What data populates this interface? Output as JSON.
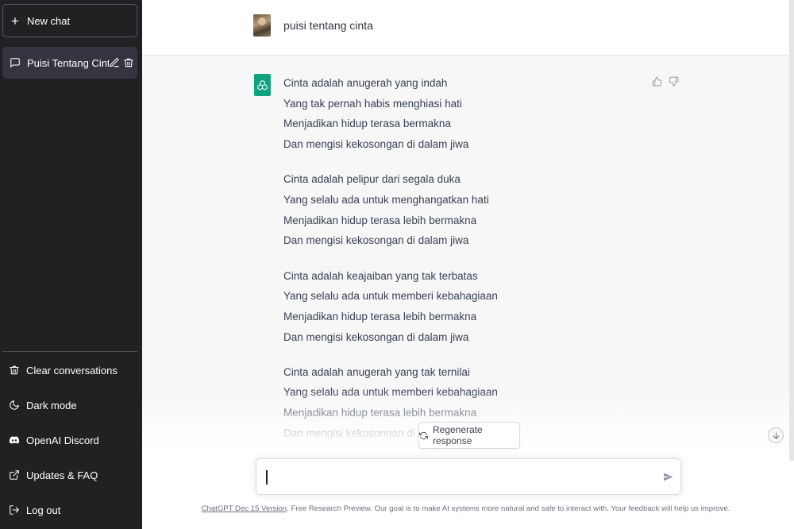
{
  "sidebar": {
    "new_chat_label": "New chat",
    "conversation_title": "Puisi Tentang Cinta",
    "links": {
      "clear": "Clear conversations",
      "dark_mode": "Dark mode",
      "discord": "OpenAI Discord",
      "updates": "Updates & FAQ",
      "logout": "Log out"
    }
  },
  "chat": {
    "user_message": "puisi tentang cinta",
    "assistant_stanzas": [
      [
        "Cinta adalah anugerah yang indah",
        "Yang tak pernah habis menghiasi hati",
        "Menjadikan hidup terasa bermakna",
        "Dan mengisi kekosongan di dalam jiwa"
      ],
      [
        "Cinta adalah pelipur dari segala duka",
        "Yang selalu ada untuk menghangatkan hati",
        "Menjadikan hidup terasa lebih bermakna",
        "Dan mengisi kekosongan di dalam jiwa"
      ],
      [
        "Cinta adalah keajaiban yang tak terbatas",
        "Yang selalu ada untuk memberi kebahagiaan",
        "Menjadikan hidup terasa lebih bermakna",
        "Dan mengisi kekosongan di dalam jiwa"
      ],
      [
        "Cinta adalah anugerah yang tak ternilai",
        "Yang selalu ada untuk memberi kebahagiaan",
        "Menjadikan hidup terasa lebih bermakna",
        "Dan mengisi kekosongan di dalam jiwa"
      ]
    ]
  },
  "regenerate_label": "Regenerate response",
  "input": {
    "value": ""
  },
  "footer": {
    "link_text": "ChatGPT Dec 15 Version",
    "text": ". Free Research Preview. Our goal is to make AI systems more natural and safe to interact with. Your feedback will help us improve."
  },
  "colors": {
    "sidebar_bg": "#202123",
    "selected_item_bg": "#343541",
    "assistant_bg": "#f7f7f8",
    "openai_green": "#10a37f"
  },
  "icons": [
    "plus-icon",
    "chat-bubble-icon",
    "edit-icon",
    "trash-icon",
    "moon-icon",
    "discord-icon",
    "external-link-icon",
    "logout-icon",
    "openai-logo-icon",
    "thumbs-up-icon",
    "thumbs-down-icon",
    "refresh-icon",
    "arrow-down-icon",
    "send-icon"
  ]
}
